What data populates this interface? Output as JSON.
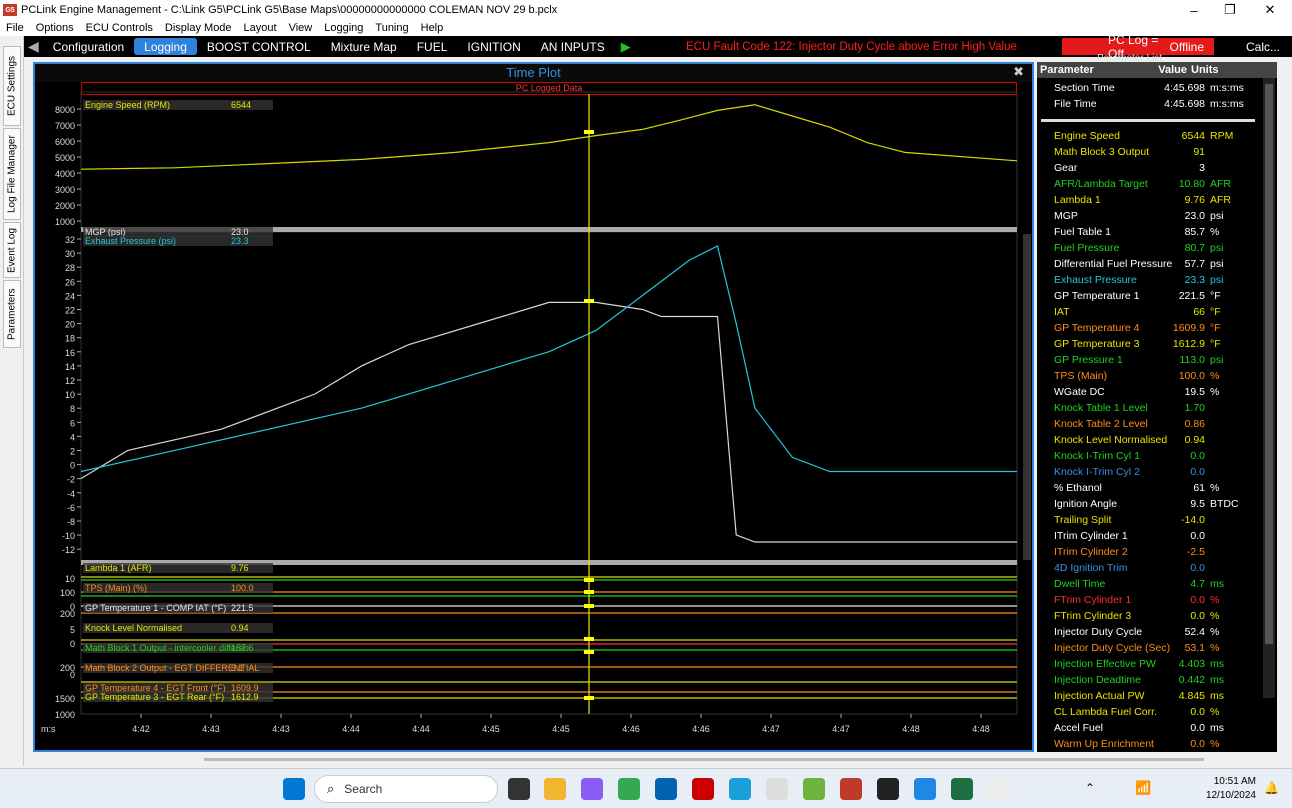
{
  "window": {
    "title": "PCLink Engine Management - C:\\Link G5\\PCLink G5\\Base Maps\\00000000000000 COLEMAN NOV 29 b.pclx",
    "app_icon": "G5",
    "minimize": "–",
    "restore": "❐",
    "close": "✕"
  },
  "menu": [
    "File",
    "Options",
    "ECU Controls",
    "Display Mode",
    "Layout",
    "View",
    "Logging",
    "Tuning",
    "Help"
  ],
  "toolbar": {
    "tabs": [
      "Configuration",
      "Logging",
      "BOOST CONTROL",
      "Mixture Map",
      "FUEL",
      "IGNITION",
      "AN INPUTS"
    ],
    "active": "Logging",
    "fault": "ECU Fault Code 122: Injector Duty Cycle above Error High Value",
    "pc_log": "PC Log = Off",
    "status": "Offline",
    "calc": "Calc..."
  },
  "side_tabs": [
    "ECU Settings",
    "Log File Manager",
    "Event Log",
    "Parameters"
  ],
  "plot": {
    "title": "Time Plot",
    "banner": "PC Logged Data",
    "x_unit": "m:s",
    "x_ticks": [
      "4:42",
      "4:43",
      "4:43",
      "4:44",
      "4:44",
      "4:45",
      "4:45",
      "4:46",
      "4:46",
      "4:47",
      "4:47",
      "4:48",
      "4:48"
    ],
    "rpm_ticks": [
      "8000",
      "7000",
      "6000",
      "5000",
      "4000",
      "3000",
      "2000",
      "1000"
    ],
    "psi_ticks": [
      "32",
      "30",
      "28",
      "26",
      "24",
      "22",
      "20",
      "18",
      "16",
      "14",
      "12",
      "10",
      "8",
      "6",
      "4",
      "2",
      "0",
      "-2",
      "-4",
      "-6",
      "-8",
      "-10",
      "-12"
    ],
    "small_ticks": [
      "10",
      "100",
      "0",
      "200",
      "5",
      "0",
      "200",
      "0",
      "1500",
      "1000"
    ],
    "labels": [
      {
        "text": "Engine Speed (RPM)",
        "val": "6544",
        "color": "#e6e600"
      },
      {
        "text": "MGP (psi)",
        "val": "23.0",
        "color": "#e8e8e8"
      },
      {
        "text": "Exhaust Pressure (psi)",
        "val": "23.3",
        "color": "#22c8d8"
      },
      {
        "text": "Lambda 1 (AFR)",
        "val": "9.76",
        "color": "#e6e600"
      },
      {
        "text": "TPS (Main) (%)",
        "val": "100.0",
        "color": "#ff8c1a"
      },
      {
        "text": "GP Temperature 1 - COMP IAT (°F)",
        "val": "221.5",
        "color": "#e8e8e8"
      },
      {
        "text": "Knock Level Normalised",
        "val": "0.94",
        "color": "#e6e600"
      },
      {
        "text": "Math Block 1 Output - intercooler differen",
        "val": "157.6",
        "color": "#22d022"
      },
      {
        "text": "Math Block 2 Output - EGT DIFFERENTIAL",
        "val": "3.1",
        "color": "#ff8c1a"
      },
      {
        "text": "GP Temperature 4 - EGT Front (°F)",
        "val": "1609.9",
        "color": "#ff8c1a"
      },
      {
        "text": "GP Temperature 3 - EGT Rear (°F)",
        "val": "1612.9",
        "color": "#e6e600"
      }
    ]
  },
  "chart_data": {
    "type": "line",
    "rpm": {
      "x": [
        0,
        0.1,
        0.2,
        0.3,
        0.4,
        0.5,
        0.55,
        0.6,
        0.64,
        0.68,
        0.72,
        0.76,
        0.8,
        0.84,
        0.88,
        1
      ],
      "values": [
        3700,
        3800,
        4100,
        4400,
        4900,
        5600,
        6100,
        6544,
        7200,
        7900,
        8300,
        7500,
        6700,
        5600,
        4900,
        4300
      ],
      "ylim": [
        0,
        8000
      ]
    },
    "mgp": {
      "x": [
        0,
        0.05,
        0.15,
        0.25,
        0.3,
        0.35,
        0.45,
        0.5,
        0.55,
        0.6,
        0.62,
        0.65,
        0.68,
        0.7,
        0.72,
        0.76,
        1
      ],
      "values": [
        -2,
        2,
        5,
        10,
        14,
        17,
        21,
        23,
        23,
        22,
        21,
        21,
        21,
        -10,
        -11,
        -11,
        -11
      ],
      "ylim": [
        -12,
        32
      ]
    },
    "exhaust": {
      "x": [
        0,
        0.1,
        0.3,
        0.4,
        0.5,
        0.55,
        0.6,
        0.65,
        0.68,
        0.7,
        0.72,
        0.76,
        0.8,
        1
      ],
      "values": [
        -1,
        2,
        8,
        12,
        16,
        19,
        24,
        29,
        31,
        20,
        8,
        1,
        -1,
        -1
      ],
      "ylim": [
        -12,
        32
      ]
    }
  },
  "params": {
    "header": [
      "Parameter",
      "Value",
      "Units"
    ],
    "title": "Parameter List",
    "rows": [
      [
        "Section Time",
        "4:45.698",
        "m:s:ms",
        "#ffffff"
      ],
      [
        "File Time",
        "4:45.698",
        "m:s:ms",
        "#ffffff"
      ],
      [
        "",
        "",
        "",
        ""
      ],
      [
        "Engine Speed",
        "6544",
        "RPM",
        "#e6e600"
      ],
      [
        "Math Block 3 Output",
        "91",
        "",
        "#e6e600"
      ],
      [
        "Gear",
        "3",
        "",
        "#ffffff"
      ],
      [
        "AFR/Lambda Target",
        "10.80",
        "AFR",
        "#22d022"
      ],
      [
        "Lambda 1",
        "9.76",
        "AFR",
        "#e6e600"
      ],
      [
        "MGP",
        "23.0",
        "psi",
        "#ffffff"
      ],
      [
        "Fuel Table 1",
        "85.7",
        "%",
        "#ffffff"
      ],
      [
        "Fuel Pressure",
        "80.7",
        "psi",
        "#22d022"
      ],
      [
        "Differential Fuel Pressure",
        "57.7",
        "psi",
        "#ffffff"
      ],
      [
        "Exhaust Pressure",
        "23.3",
        "psi",
        "#22c8d8"
      ],
      [
        "GP Temperature 1",
        "221.5",
        "°F",
        "#ffffff"
      ],
      [
        "IAT",
        "66",
        "°F",
        "#e6e600"
      ],
      [
        "GP Temperature 4",
        "1609.9",
        "°F",
        "#ff8c1a"
      ],
      [
        "GP Temperature 3",
        "1612.9",
        "°F",
        "#e6e600"
      ],
      [
        "GP Pressure 1",
        "113.0",
        "psi",
        "#22d022"
      ],
      [
        "TPS (Main)",
        "100.0",
        "%",
        "#ff8c1a"
      ],
      [
        "WGate DC",
        "19.5",
        "%",
        "#ffffff"
      ],
      [
        "Knock Table 1 Level",
        "1.70",
        "",
        "#22d022"
      ],
      [
        "Knock Table 2 Level",
        "0.86",
        "",
        "#ff8c1a"
      ],
      [
        "Knock Level Normalised",
        "0.94",
        "",
        "#e6e600"
      ],
      [
        "Knock I-Trim Cyl 1",
        "0.0",
        "",
        "#22d022"
      ],
      [
        "Knock I-Trim Cyl 2",
        "0.0",
        "",
        "#3a8fe6"
      ],
      [
        "% Ethanol",
        "61",
        "%",
        "#ffffff"
      ],
      [
        "Ignition Angle",
        "9.5",
        "BTDC",
        "#ffffff"
      ],
      [
        "Trailing Split",
        "-14.0",
        "",
        "#e6e600"
      ],
      [
        "ITrim Cylinder 1",
        "0.0",
        "",
        "#ffffff"
      ],
      [
        "ITrim Cylinder 2",
        "-2.5",
        "",
        "#ff8c1a"
      ],
      [
        "4D Ignition Trim",
        "0.0",
        "",
        "#3a8fe6"
      ],
      [
        "Dwell Time",
        "4.7",
        "ms",
        "#22d022"
      ],
      [
        "FTrim Cylinder 1",
        "0.0",
        "%",
        "#ff3030"
      ],
      [
        "FTrim Cylinder 3",
        "0.0",
        "%",
        "#e6e600"
      ],
      [
        "Injector Duty Cycle",
        "52.4",
        "%",
        "#ffffff"
      ],
      [
        "Injector Duty Cycle (Sec)",
        "53.1",
        "%",
        "#ff8c1a"
      ],
      [
        "Injection Effective PW",
        "4.403",
        "ms",
        "#22d022"
      ],
      [
        "Injection Deadtime",
        "0.442",
        "ms",
        "#22d022"
      ],
      [
        "Injection Actual PW",
        "4.845",
        "ms",
        "#e6e600"
      ],
      [
        "CL Lambda Fuel Corr.",
        "0.0",
        "%",
        "#e6e600"
      ],
      [
        "Accel Fuel",
        "0.0",
        "ms",
        "#ffffff"
      ],
      [
        "Warm Up Enrichment",
        "0.0",
        "%",
        "#ff8c1a"
      ]
    ]
  },
  "taskbar": {
    "search_placeholder": "Search",
    "time": "10:51 AM",
    "date": "12/10/2024"
  }
}
